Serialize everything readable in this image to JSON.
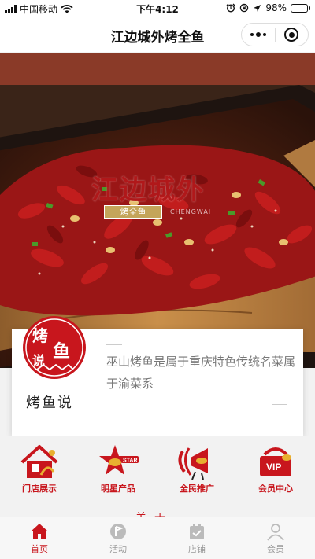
{
  "status_bar": {
    "carrier": "中国移动",
    "time": "下午4:12",
    "battery_percent": "98%",
    "battery_level": 0.98
  },
  "nav": {
    "title": "江边城外烤全鱼",
    "menu_icon": "more-dots-icon",
    "close_icon": "target-icon"
  },
  "hero": {
    "logo_text": "江边城外",
    "badge_text": "烤全鱼",
    "sub_text": "CHENGWAI"
  },
  "intro": {
    "caption": "烤鱼说",
    "logo_glyphs": [
      "烤",
      "鱼",
      "说"
    ],
    "text": "巫山烤鱼是属于重庆特色传统名菜属于渝菜系"
  },
  "features": [
    {
      "label": "门店展示",
      "icon": "store-icon"
    },
    {
      "label": "明星产品",
      "icon": "star-product-icon"
    },
    {
      "label": "全民推广",
      "icon": "promotion-icon"
    },
    {
      "label": "会员中心",
      "icon": "vip-icon"
    }
  ],
  "peek_text": "关于",
  "tabs": [
    {
      "label": "首页",
      "icon": "home-icon",
      "active": true
    },
    {
      "label": "活动",
      "icon": "activity-icon",
      "active": false
    },
    {
      "label": "店铺",
      "icon": "shop-icon",
      "active": false
    },
    {
      "label": "会员",
      "icon": "member-icon",
      "active": false
    }
  ],
  "colors": {
    "accent": "#c8161d",
    "inactive": "#999999",
    "battery": "#4cd964"
  }
}
